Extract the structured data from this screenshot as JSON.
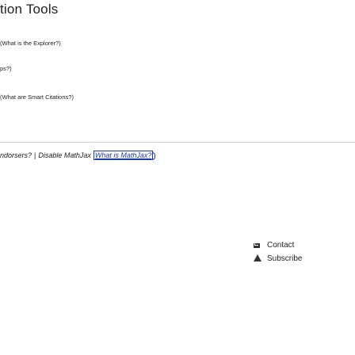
{
  "section": {
    "title": "tion Tools"
  },
  "tools": {
    "line1": {
      "prefix": "(",
      "link": "What is the Explorer?",
      "suffix": ")"
    },
    "line2": {
      "text": "ps?)"
    },
    "line3": {
      "prefix": "(",
      "link": "What are Smart Citations?",
      "suffix": ")"
    }
  },
  "mathjax": {
    "endorsers_text": "ndorsers?",
    "separator": "|",
    "disable_label": "Disable MathJax",
    "what_is_label": "What is MathJax?"
  },
  "footer": {
    "contact_label": "Contact",
    "subscribe_label": "Subscribe",
    "contact_icon": "envelope-icon",
    "subscribe_icon": "bell-icon"
  }
}
